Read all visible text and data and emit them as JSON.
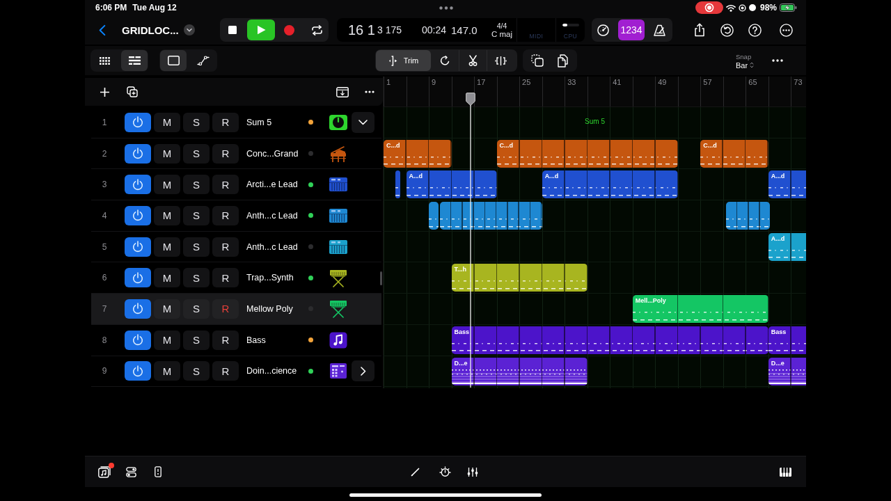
{
  "status_bar": {
    "time": "6:06 PM",
    "date": "Tue Aug 12",
    "screen_recording": true,
    "battery": "98%",
    "charging": true
  },
  "control_bar": {
    "project_title": "GRIDLOC...",
    "transport": {
      "playing": true
    },
    "lcd": {
      "bar": "16 1",
      "beat": "3 175",
      "time": "00:24",
      "tempo": "147.0",
      "signature": "4/4",
      "key": "C maj",
      "midi_label": "MIDI",
      "cpu_label": "CPU",
      "cpu": {
        "level": 0.3
      }
    },
    "count_in": {
      "label": "1234",
      "on": true
    }
  },
  "toolbar": {
    "view_buttons": [
      {
        "kind": "grid",
        "selected": false
      },
      {
        "kind": "list",
        "selected": true
      }
    ],
    "region_buttons": [
      {
        "kind": "region",
        "selected": true
      },
      {
        "kind": "automation",
        "selected": false
      }
    ],
    "tools": [
      {
        "kind": "trim",
        "label": "Trim",
        "selected": true
      },
      {
        "kind": "loop",
        "selected": false
      },
      {
        "kind": "scissors",
        "selected": false
      },
      {
        "kind": "split",
        "selected": false
      }
    ],
    "snap": {
      "label": "Snap",
      "value": "Bar"
    }
  },
  "ruler": {
    "marks": [
      "1",
      "9",
      "17",
      "25",
      "33",
      "41",
      "49",
      "57",
      "65",
      "73"
    ]
  },
  "tracks": [
    {
      "number": "1",
      "name": "Sum 5",
      "power": true,
      "buttons": [
        {
          "kind": "mute",
          "label": "M",
          "on": false
        },
        {
          "kind": "solo",
          "label": "S",
          "on": false
        },
        {
          "kind": "record",
          "label": "R",
          "on": false
        }
      ],
      "indicator": {
        "color": "#f2a33a"
      },
      "kind": "summing",
      "color": "#2ed52e",
      "expanded": true,
      "selected": false,
      "lane_label": "Sum 5"
    },
    {
      "number": "2",
      "name": "Conc...Grand",
      "power": true,
      "buttons": [
        {
          "kind": "mute",
          "label": "M",
          "on": false
        },
        {
          "kind": "solo",
          "label": "S",
          "on": false
        },
        {
          "kind": "record",
          "label": "R",
          "on": false
        }
      ],
      "indicator": {
        "color": "#2c2c2e"
      },
      "kind": "piano",
      "color": "#c5560f",
      "selected": false,
      "regions": [
        {
          "label": "C...d",
          "selected": false
        },
        {
          "label": "C...d",
          "selected": false
        },
        {
          "label": "C...d",
          "selected": false
        }
      ]
    },
    {
      "number": "3",
      "name": "Arcti...e Lead",
      "power": true,
      "buttons": [
        {
          "kind": "mute",
          "label": "M",
          "on": false
        },
        {
          "kind": "solo",
          "label": "S",
          "on": false
        },
        {
          "kind": "record",
          "label": "R",
          "on": false
        }
      ],
      "indicator": {
        "color": "#30d158"
      },
      "kind": "keyboard",
      "color": "#2050d0",
      "selected": false,
      "regions": [
        {
          "selected": false
        },
        {
          "label": "A...d",
          "selected": false
        },
        {
          "label": "A...d",
          "selected": false
        },
        {
          "label": "A...d",
          "selected": false
        }
      ]
    },
    {
      "number": "4",
      "name": "Anth...c Lead",
      "power": true,
      "buttons": [
        {
          "kind": "mute",
          "label": "M",
          "on": false
        },
        {
          "kind": "solo",
          "label": "S",
          "on": false
        },
        {
          "kind": "record",
          "label": "R",
          "on": false
        }
      ],
      "indicator": {
        "color": "#30d158"
      },
      "kind": "keyboard",
      "color": "#1e88d2",
      "selected": false,
      "regions": [
        {
          "selected": false
        },
        {
          "selected": false
        },
        {
          "selected": false
        }
      ]
    },
    {
      "number": "5",
      "name": "Anth...c Lead",
      "power": true,
      "buttons": [
        {
          "kind": "mute",
          "label": "M",
          "on": false
        },
        {
          "kind": "solo",
          "label": "S",
          "on": false
        },
        {
          "kind": "record",
          "label": "R",
          "on": false
        }
      ],
      "indicator": {
        "color": "#2c2c2e"
      },
      "kind": "keyboard",
      "color": "#1ba2cc",
      "selected": false,
      "regions": [
        {
          "label": "A...d",
          "selected": false
        }
      ]
    },
    {
      "number": "6",
      "name": "Trap...Synth",
      "power": true,
      "buttons": [
        {
          "kind": "mute",
          "label": "M",
          "on": false
        },
        {
          "kind": "solo",
          "label": "S",
          "on": false
        },
        {
          "kind": "record",
          "label": "R",
          "on": false
        }
      ],
      "indicator": {
        "color": "#30d158"
      },
      "kind": "keyboard_stand",
      "color": "#a8b520",
      "selected": false,
      "regions": [
        {
          "label": "T...h",
          "selected": false
        }
      ]
    },
    {
      "number": "7",
      "name": "Mellow Poly",
      "power": true,
      "buttons": [
        {
          "kind": "mute",
          "label": "M",
          "on": false
        },
        {
          "kind": "solo",
          "label": "S",
          "on": false
        },
        {
          "kind": "record",
          "label": "R",
          "on": true
        }
      ],
      "indicator": {
        "color": "#2c2c2e"
      },
      "kind": "keyboard_stand",
      "color": "#14c664",
      "selected": true,
      "regions": [
        {
          "label": "Mell...Poly",
          "selected": false
        }
      ]
    },
    {
      "number": "8",
      "name": "Bass",
      "power": true,
      "buttons": [
        {
          "kind": "mute",
          "label": "M",
          "on": false
        },
        {
          "kind": "solo",
          "label": "S",
          "on": false
        },
        {
          "kind": "record",
          "label": "R",
          "on": false
        }
      ],
      "indicator": {
        "color": "#f2a33a"
      },
      "kind": "note",
      "color": "#4c14ca",
      "selected": false,
      "regions": [
        {
          "label": "Bass",
          "selected": false
        },
        {
          "label": "Bass",
          "selected": false
        }
      ]
    },
    {
      "number": "9",
      "name": "Doin...cience",
      "power": true,
      "buttons": [
        {
          "kind": "mute",
          "label": "M",
          "on": false
        },
        {
          "kind": "solo",
          "label": "S",
          "on": false
        },
        {
          "kind": "record",
          "label": "R",
          "on": false
        }
      ],
      "indicator": {
        "color": "#30d158"
      },
      "kind": "drum_machine",
      "color": "#5b22d4",
      "expanded": false,
      "selected": false,
      "regions": [
        {
          "label": "D...e",
          "selected": false
        },
        {
          "label": "D...e",
          "selected": false
        }
      ]
    }
  ],
  "bottom_bar": {
    "library_badge": true
  }
}
